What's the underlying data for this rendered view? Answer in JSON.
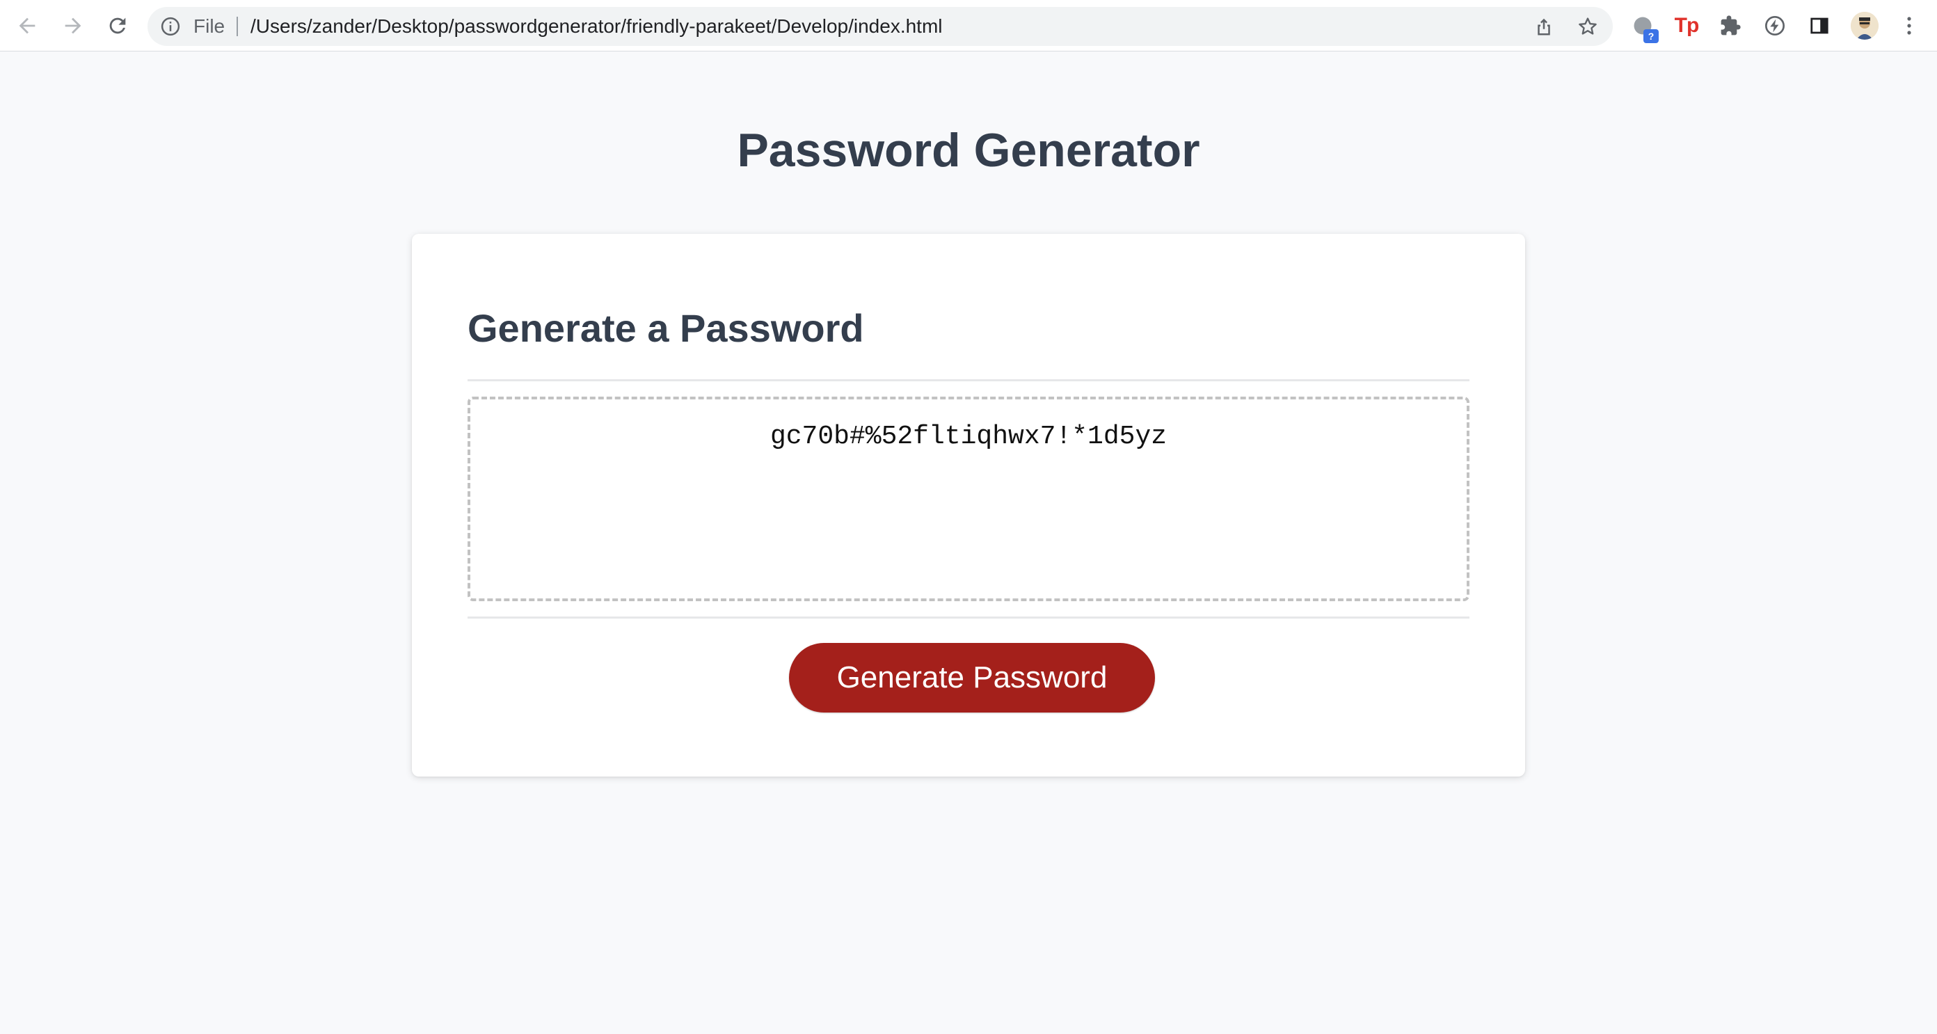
{
  "browser": {
    "scheme_label": "File",
    "url": "/Users/zander/Desktop/passwordgenerator/friendly-parakeet/Develop/index.html",
    "extensions": [
      {
        "name": "extension-unknown",
        "badge": "?"
      },
      {
        "name": "extension-tp",
        "label": "Tp"
      },
      {
        "name": "extensions-puzzle"
      },
      {
        "name": "extension-bolt"
      }
    ]
  },
  "page": {
    "title": "Password Generator",
    "card": {
      "title": "Generate a Password",
      "password_value": "gc70b#%52fltiqhwx7!*1d5yz",
      "button_label": "Generate Password"
    }
  },
  "colors": {
    "background": "#f8f9fb",
    "heading": "#343e4d",
    "button": "#a4201b",
    "dashed_border": "#c2c2c2"
  }
}
